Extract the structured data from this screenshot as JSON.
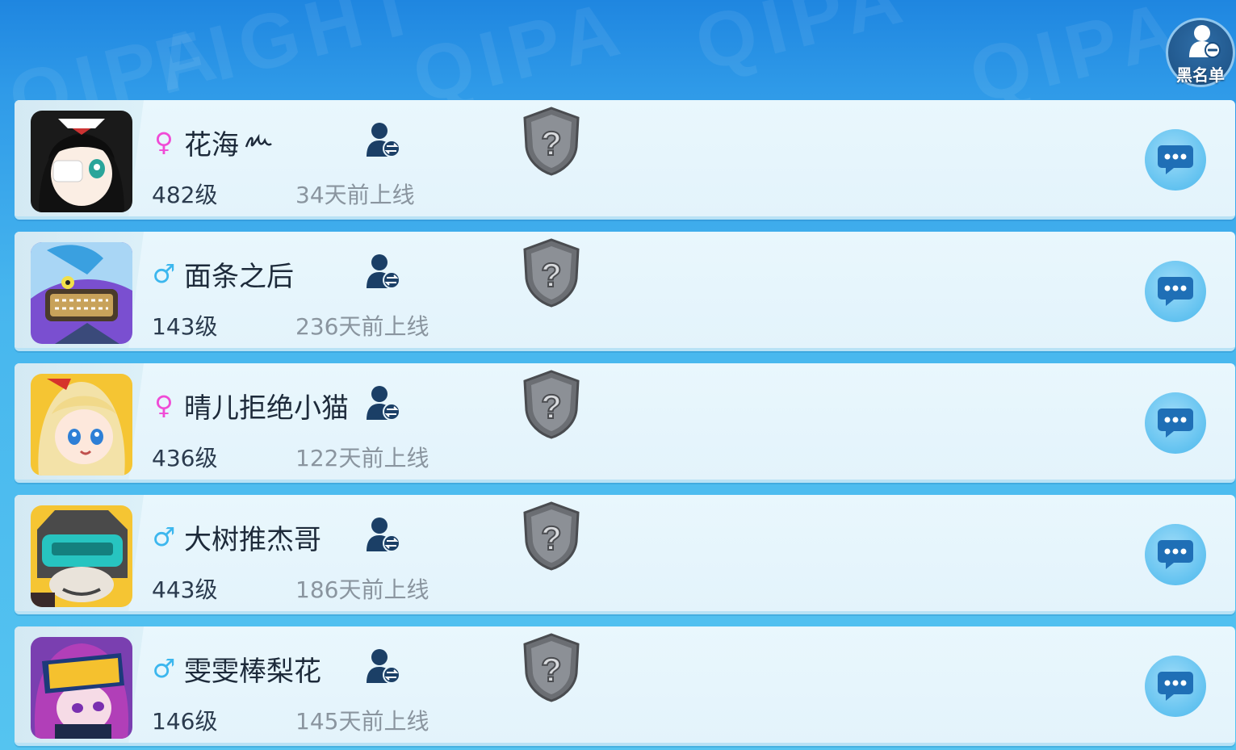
{
  "header": {
    "blacklist_label": "黑名单"
  },
  "watermark": [
    "FIGHT",
    "QIPA",
    "QIPA",
    "QIPA",
    "QIPA"
  ],
  "colors": {
    "female": "#f04bd6",
    "male": "#3cb7ee",
    "row_bg": "#e6f5fc",
    "accent": "#1b4f82"
  },
  "friends": [
    {
      "gender": "female",
      "gender_symbol": "♀",
      "name": "花海",
      "level": "482级",
      "last_online": "34天前上线",
      "avatar": "black-hair-eyepatch-girl",
      "rank_icon": "unknown-rank-shield-icon"
    },
    {
      "gender": "male",
      "gender_symbol": "♂",
      "name": "面条之后",
      "level": "143级",
      "last_online": "236天前上线",
      "avatar": "blue-masked-monster",
      "rank_icon": "unknown-rank-shield-icon"
    },
    {
      "gender": "female",
      "gender_symbol": "♀",
      "name": "晴儿拒绝小猫",
      "level": "436级",
      "last_online": "122天前上线",
      "avatar": "blonde-girl",
      "rank_icon": "unknown-rank-shield-icon"
    },
    {
      "gender": "male",
      "gender_symbol": "♂",
      "name": "大树推杰哥",
      "level": "443级",
      "last_online": "186天前上线",
      "avatar": "teal-helmet-robot",
      "rank_icon": "unknown-rank-shield-icon"
    },
    {
      "gender": "male",
      "gender_symbol": "♂",
      "name": "雯雯棒梨花",
      "level": "146级",
      "last_online": "145天前上线",
      "avatar": "goggles-purple-hair",
      "rank_icon": "unknown-rank-shield-icon"
    }
  ]
}
